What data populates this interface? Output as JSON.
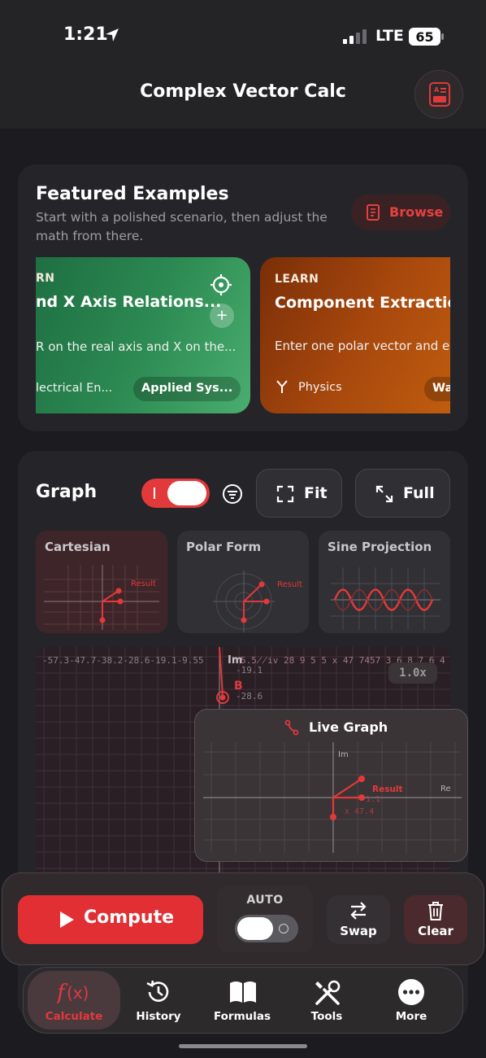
{
  "status": {
    "time": "1:21",
    "network": "LTE",
    "battery": "65"
  },
  "header": {
    "title": "Complex Vector Calc",
    "icon": "report-icon"
  },
  "featured": {
    "title": "Featured Examples",
    "subtitle": "Start with a polished scenario, then adjust the math from there.",
    "browse_label": "Browse",
    "cards": [
      {
        "tag": "RN",
        "title": "nd X Axis Relations...",
        "desc": "R on the real axis and X on the...",
        "category": "lectrical En...",
        "pill": "Applied Sys...",
        "color": "#2c8a52"
      },
      {
        "tag": "LEARN",
        "title": "Component Extraction",
        "desc": "Enter one polar vector and e",
        "category": "Physics",
        "pill": "Wa",
        "color": "#a8480d"
      }
    ]
  },
  "graph": {
    "title": "Graph",
    "fit_label": "Fit",
    "full_label": "Full",
    "modes": [
      {
        "label": "Cartesian",
        "result_label": "Result"
      },
      {
        "label": "Polar Form",
        "result_label": "Result"
      },
      {
        "label": "Sine Projection"
      }
    ],
    "big": {
      "axis_ticks_top": "-57.3-47.7-38.2-28.6-19.1-9.55",
      "im_label": "Im",
      "overlap_text": "5.5̸̸iv 28 9 5 5 x 47 7457 3 6 8 7 6 4",
      "y_tick_1": "-19.1",
      "y_tick_2": "-28.6",
      "vector_label": "B",
      "zoom": "1.0x"
    },
    "live": {
      "title": "Live Graph",
      "im_label": "Im",
      "re_label": "Re",
      "result_label": "Result",
      "readout_1": "1.1",
      "readout_2": "x 47.4"
    },
    "accent": "#e2393a"
  },
  "actions": {
    "compute_label": "Compute",
    "auto_label": "AUTO",
    "auto_on": false,
    "swap_label": "Swap",
    "clear_label": "Clear"
  },
  "tabs": [
    {
      "label": "Calculate",
      "icon": "function-icon",
      "active": true
    },
    {
      "label": "History",
      "icon": "history-icon",
      "active": false
    },
    {
      "label": "Formulas",
      "icon": "book-icon",
      "active": false
    },
    {
      "label": "Tools",
      "icon": "tools-icon",
      "active": false
    },
    {
      "label": "More",
      "icon": "more-icon",
      "active": false
    }
  ]
}
